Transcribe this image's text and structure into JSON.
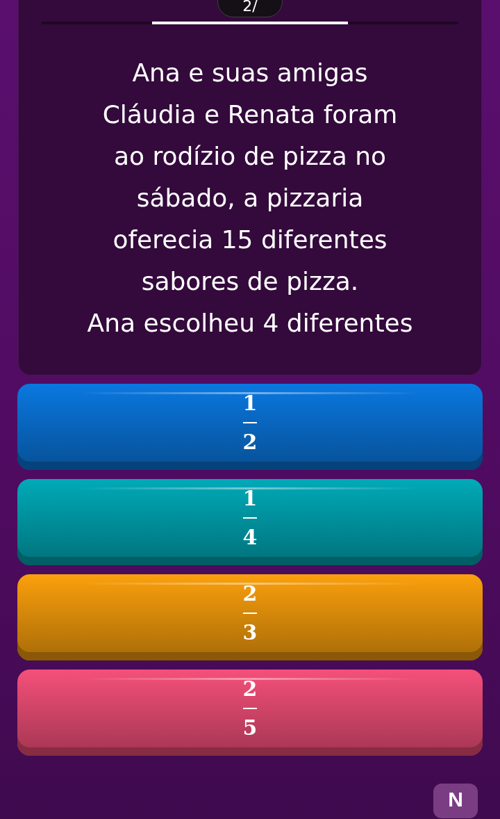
{
  "counter": "2/",
  "timer": {
    "level": 0.47
  },
  "question": "Ana e suas amigas\nCláudia e Renata foram\nao rodízio de pizza no\nsábado, a pizzaria\noferecia 15 diferentes\nsabores de pizza.\nAna escolheu 4 diferentes",
  "answers": [
    {
      "numerator": "1",
      "denominator": "2",
      "color": "#0a78e0"
    },
    {
      "numerator": "1",
      "denominator": "4",
      "color": "#00aab8"
    },
    {
      "numerator": "2",
      "denominator": "3",
      "color": "#fba00c"
    },
    {
      "numerator": "2",
      "denominator": "5",
      "color": "#f5507a"
    }
  ],
  "next_button": "N"
}
